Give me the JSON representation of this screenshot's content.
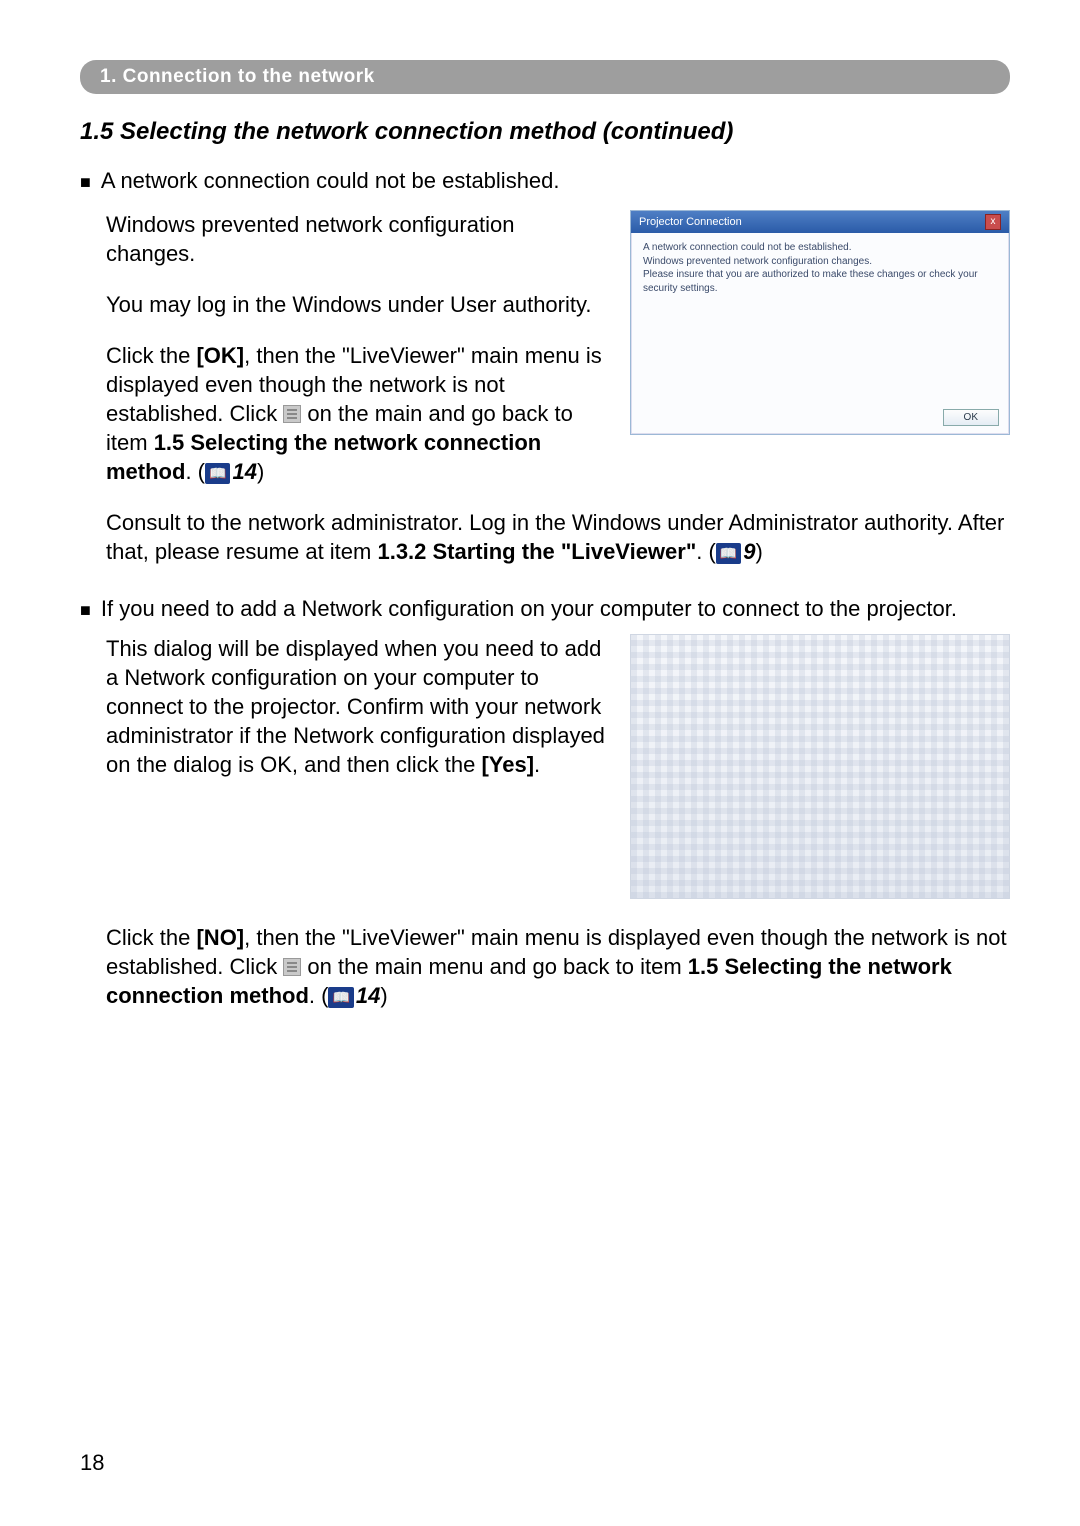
{
  "header": {
    "tab": "1. Connection to the network"
  },
  "section_title": "1.5 Selecting the network connection method (continued)",
  "bullet_a": "A network connection could not be established.",
  "para_a1": "Windows prevented network configuration changes.",
  "para_a2": "You may log in the Windows under User authority.",
  "para_a3_pre": "Click the ",
  "para_a3_ok": "[OK]",
  "para_a3_mid": ", then the \"LiveViewer\" main menu is displayed even though the network is not established. Click ",
  "para_a3_post": " on the main and go back to item ",
  "para_a3_bold": "1.5 Selecting the network connection method",
  "para_a3_end": ". (",
  "ref_a3": "14",
  "close_paren": ")",
  "para_a4_pre": "Consult to the network administrator. Log in the Windows under Administrator authority. After that, please resume at item ",
  "para_a4_bold": "1.3.2 Starting the \"LiveViewer\"",
  "para_a4_end": ". (",
  "ref_a4": "9",
  "bullet_b": "If you need to add a Network configuration on your computer to connect to the projector.",
  "para_b1_pre": "This dialog will be displayed when you need to add a Network configuration on your computer to connect to the projector. Confirm with your network administrator if the Network configuration displayed on the dialog is OK, and then click the ",
  "para_b1_yes": "[Yes]",
  "para_b1_end": ".",
  "para_b2_pre": "Click the ",
  "para_b2_no": "[NO]",
  "para_b2_mid": ", then the \"LiveViewer\" main menu is displayed even though the network is not established. Click ",
  "para_b2_post": " on the main menu and go back to item ",
  "para_b2_bold": "1.5 Selecting the network connection method",
  "para_b2_end": ". (",
  "ref_b2": "14",
  "dialog": {
    "title": "Projector Connection",
    "line1": "A network connection could not be established.",
    "line2": "Windows prevented network configuration changes.",
    "line3": "Please insure that you are authorized to make these changes or check your security settings.",
    "ok": "OK"
  },
  "page_number": "18"
}
